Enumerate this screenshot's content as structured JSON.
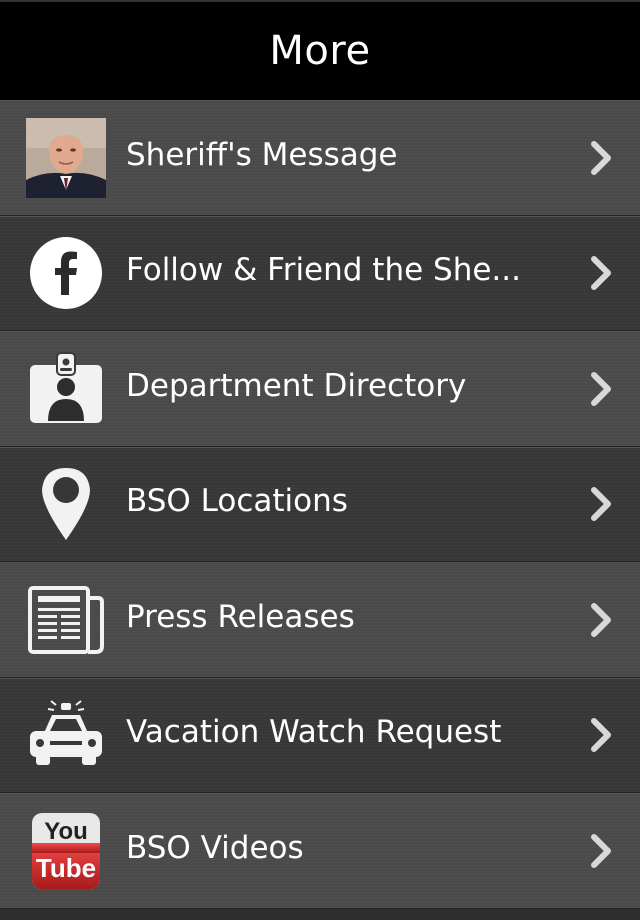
{
  "header": {
    "title": "More"
  },
  "items": [
    {
      "label": "Sheriff's Message",
      "icon": "sheriff-photo"
    },
    {
      "label": "Follow & Friend the She...",
      "icon": "facebook-icon"
    },
    {
      "label": "Department Directory",
      "icon": "id-badge-icon"
    },
    {
      "label": "BSO Locations",
      "icon": "map-pin-icon"
    },
    {
      "label": "Press Releases",
      "icon": "newspaper-icon"
    },
    {
      "label": "Vacation Watch Request",
      "icon": "police-car-icon"
    },
    {
      "label": "BSO Videos",
      "icon": "youtube-icon"
    }
  ],
  "colors": {
    "header_bg": "#000000",
    "row_light": "#4a4a4a",
    "row_dark": "#373737",
    "text": "#ffffff",
    "chevron": "#d8d8d8",
    "youtube_red": "#cc2222"
  }
}
